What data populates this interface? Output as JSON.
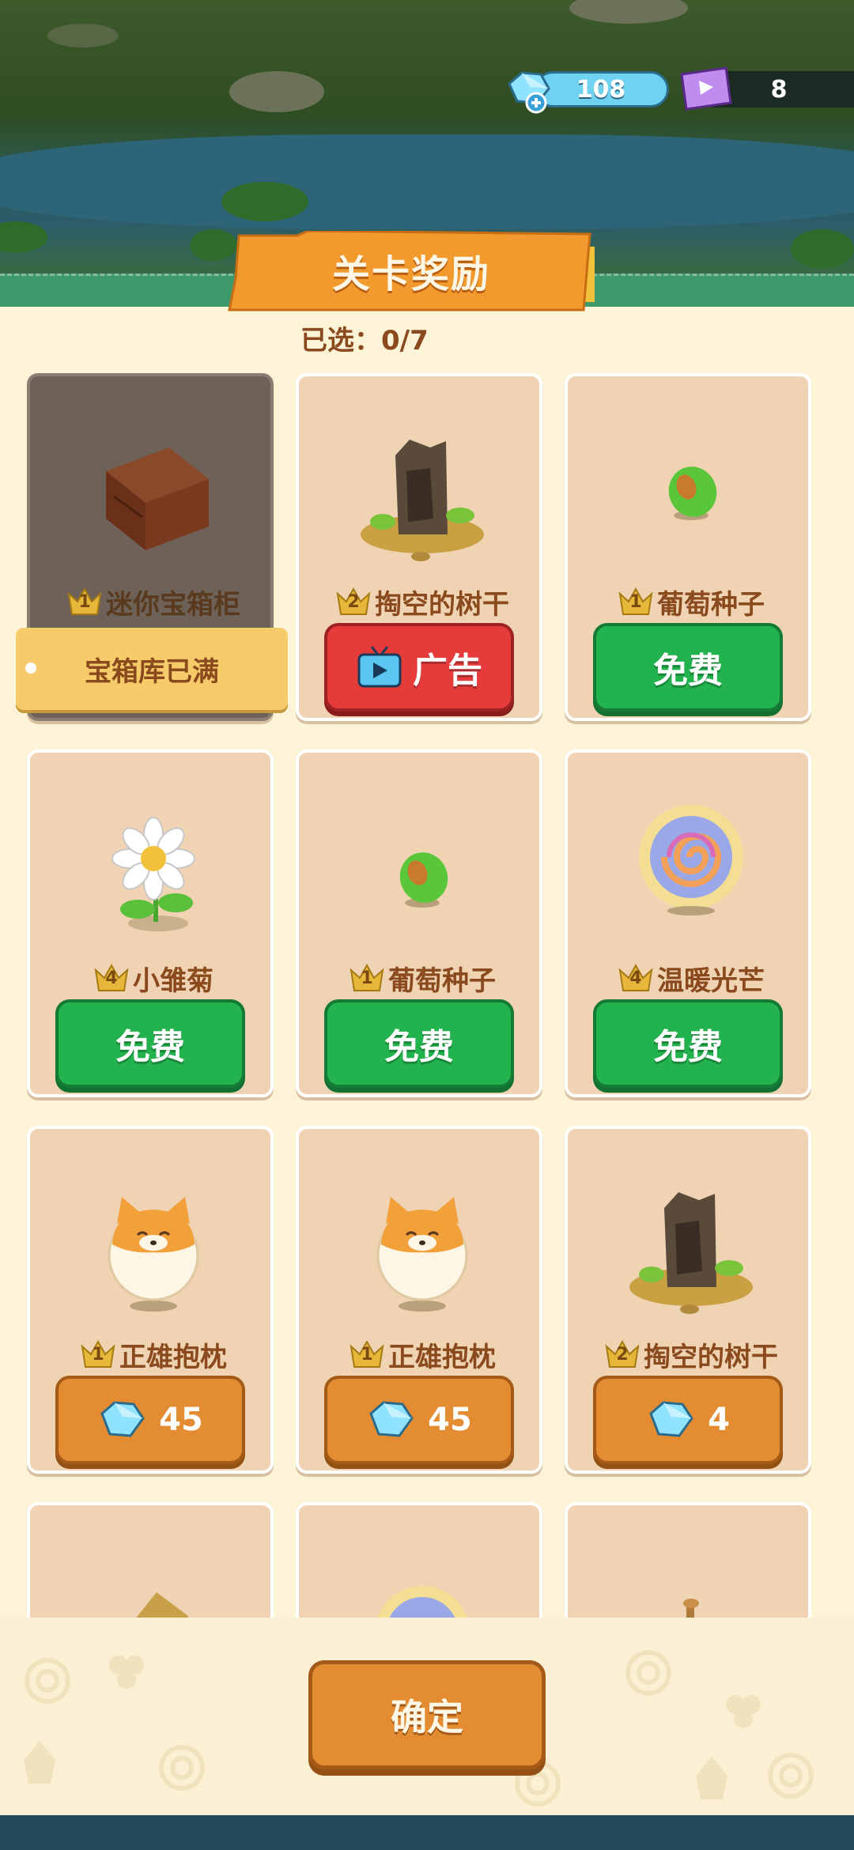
{
  "currency": {
    "gems": "108",
    "tickets": "8"
  },
  "panel": {
    "title": "关卡奖励",
    "selected_label": "已选：0/7"
  },
  "cards": [
    {
      "tier": "1",
      "name": "迷你宝箱柜",
      "art": "wooden-chest-icon",
      "status": "宝箱库已满",
      "action": "full"
    },
    {
      "tier": "2",
      "name": "掏空的树干",
      "art": "hollow-stump-icon",
      "button": "广告",
      "action": "ad"
    },
    {
      "tier": "1",
      "name": "葡萄种子",
      "art": "grape-seed-icon",
      "button": "免费",
      "action": "free"
    },
    {
      "tier": "4",
      "name": "小雏菊",
      "art": "daisy-icon",
      "button": "免费",
      "action": "free"
    },
    {
      "tier": "1",
      "name": "葡萄种子",
      "art": "grape-seed-icon",
      "button": "免费",
      "action": "free"
    },
    {
      "tier": "4",
      "name": "温暖光芒",
      "art": "warm-light-orb-icon",
      "button": "免费",
      "action": "free"
    },
    {
      "tier": "1",
      "name": "正雄抱枕",
      "art": "shiba-pillow-icon",
      "button": "45",
      "action": "gem"
    },
    {
      "tier": "1",
      "name": "正雄抱枕",
      "art": "shiba-pillow-icon",
      "button": "45",
      "action": "gem"
    },
    {
      "tier": "2",
      "name": "掏空的树干",
      "art": "hollow-stump-icon",
      "button": "4",
      "action": "gem"
    }
  ],
  "footer": {
    "confirm_label": "确定"
  },
  "colors": {
    "free_green": "#22b34e",
    "ad_red": "#e53b3b",
    "gem_orange": "#e48c32",
    "card_bg": "#efd3b3",
    "text_brown": "#8a4a1e"
  }
}
